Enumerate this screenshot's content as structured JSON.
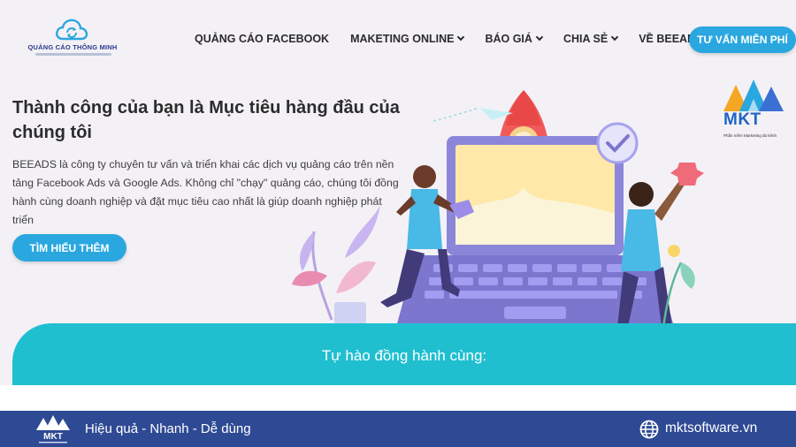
{
  "header": {
    "logo_text": "QUẢNG CÁO THÔNG MINH",
    "nav": [
      {
        "label": "QUẢNG CÁO FACEBOOK",
        "dropdown": false
      },
      {
        "label": "MAKETING ONLINE",
        "dropdown": true
      },
      {
        "label": "BÁO GIÁ",
        "dropdown": true
      },
      {
        "label": "CHIA SẺ",
        "dropdown": true
      },
      {
        "label": "VỀ BEEADS",
        "dropdown": true
      }
    ],
    "cta_label": "TƯ VẤN MIỄN PHÍ"
  },
  "hero": {
    "title": "Thành công của bạn là Mục tiêu hàng đầu của chúng tôi",
    "description": "BEEADS là công ty chuyên tư vấn và triển khai các dịch vụ quảng cáo trên nền tảng Facebook Ads và Google Ads. Không chỉ \"chạy\" quảng cáo, chúng tôi đồng hành cùng doanh nghiệp và đặt mục tiêu cao nhất là giúp doanh nghiệp phát triển",
    "button_label": "TÌM HIỂU THÊM"
  },
  "badge": {
    "text": "MKT",
    "subtitle": "Phần mềm Marketing đa kênh"
  },
  "partners": {
    "title": "Tự hào đồng hành cùng:"
  },
  "footer": {
    "logo_text": "MKT",
    "tagline": "Hiệu quả - Nhanh - Dễ dùng",
    "website": "mktsoftware.vn"
  },
  "colors": {
    "accent": "#2aa7df",
    "band": "#1fbfd0",
    "footer": "#2f4a94",
    "page_bg": "#f4f1f6"
  },
  "icons": [
    "cloud-refresh-logo-icon",
    "chevron-down-icon",
    "rocket-illustration",
    "checkmark-icon",
    "globe-icon",
    "mkt-logo-icon"
  ]
}
